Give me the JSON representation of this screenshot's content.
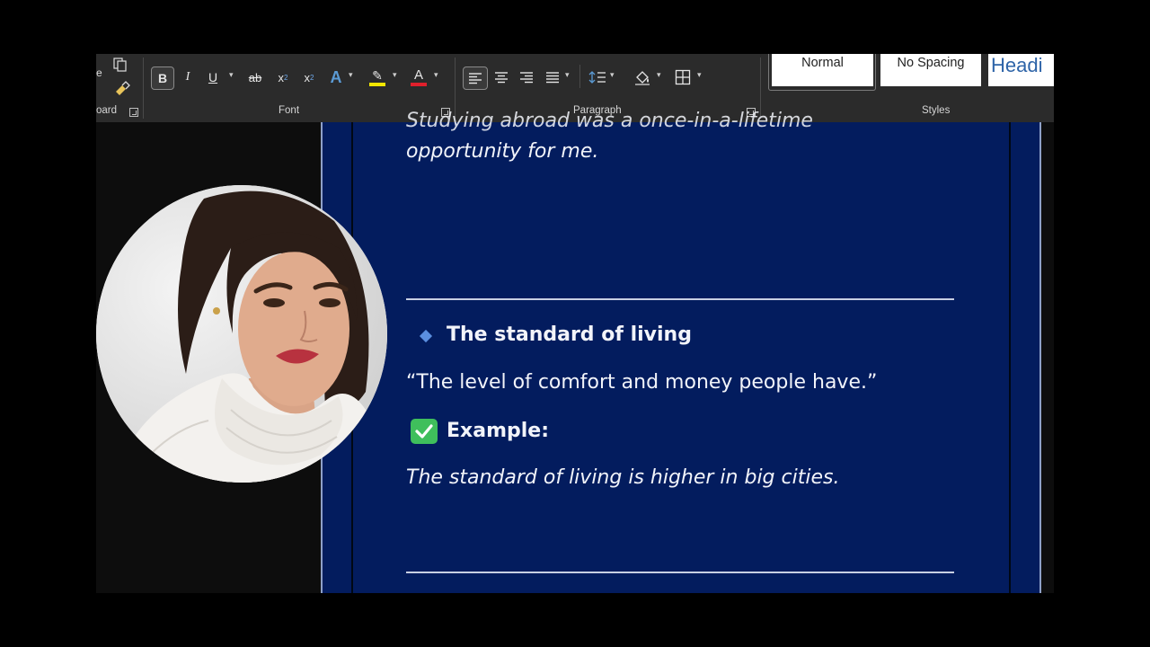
{
  "ribbon": {
    "groups": {
      "clipboard_label": "oard",
      "clipboard_partial": "e",
      "font_label": "Font",
      "paragraph_label": "Paragraph",
      "styles_label": "Styles"
    },
    "font_buttons": {
      "bold": "B",
      "italic": "I",
      "underline": "U",
      "strike": "ab",
      "subscript": "x",
      "subscript_mark": "2",
      "superscript": "x",
      "superscript_mark": "2",
      "text_effects": "A",
      "highlight": "✎",
      "font_color": "A"
    },
    "colors": {
      "highlight_bar": "#f2e600",
      "font_color_bar": "#e0202c",
      "text_effects": "#5b9bd5"
    },
    "styles": [
      {
        "label": "Normal"
      },
      {
        "label": "No Spacing"
      },
      {
        "label": "Headi"
      }
    ]
  },
  "document": {
    "cut_line": "Studying abroad was a once-in-a-lifetime",
    "line_1": "opportunity for me.",
    "heading": "The standard of living",
    "definition": "“The level of comfort and money people have.”",
    "example_label": "Example:",
    "example_text": "The standard of living is higher in big cities.",
    "colors": {
      "page_background": "#031c5e",
      "bullet": "#5b8fe0",
      "check_badge": "#3fbf5c"
    }
  },
  "webcam": {
    "icon": "person-video-feed"
  }
}
